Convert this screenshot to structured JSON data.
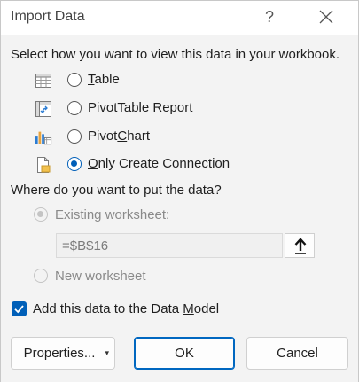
{
  "dialog": {
    "title": "Import Data",
    "help_glyph": "?",
    "view_prompt": "Select how you want to view this data in your workbook.",
    "view_options": [
      {
        "pre": "",
        "u": "T",
        "post": "able",
        "icon": "table-icon",
        "selected": false
      },
      {
        "pre": "",
        "u": "P",
        "post": "ivotTable Report",
        "icon": "pivottable-icon",
        "selected": false
      },
      {
        "pre": "Pivot",
        "u": "C",
        "post": "hart",
        "icon": "pivotchart-icon",
        "selected": false
      },
      {
        "pre": "",
        "u": "O",
        "post": "nly Create Connection",
        "icon": "connection-icon",
        "selected": true
      }
    ],
    "put_prompt": "Where do you want to put the data?",
    "existing_worksheet_label": "Existing worksheet:",
    "existing_worksheet_selected": true,
    "reference_value": "=$B$16",
    "new_worksheet_label": "New worksheet",
    "data_model": {
      "pre": "Add this data to the Data ",
      "u": "M",
      "post": "odel",
      "checked": true
    },
    "buttons": {
      "properties": "Properties...",
      "properties_caret": "▾",
      "ok": "OK",
      "cancel": "Cancel"
    },
    "accent_color": "#005fb8"
  }
}
